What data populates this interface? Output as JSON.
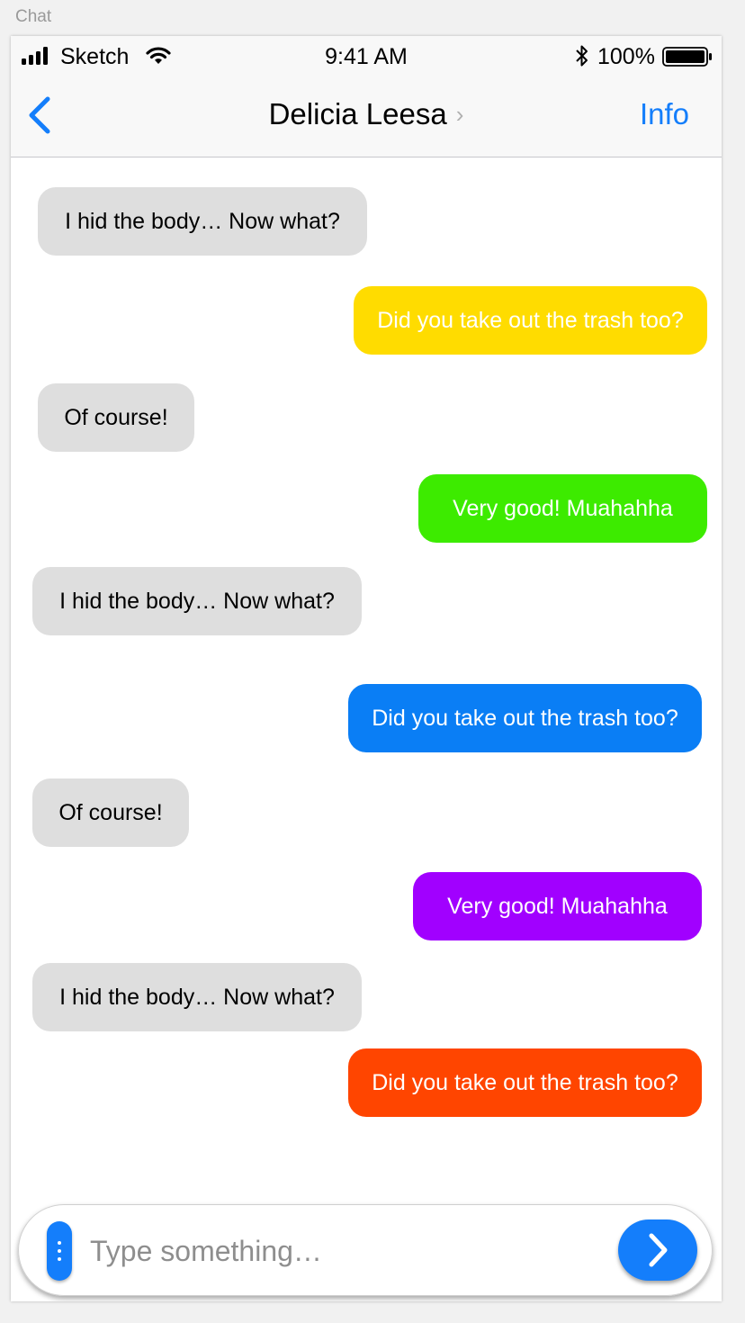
{
  "artboard": {
    "label": "Chat"
  },
  "status_bar": {
    "carrier": "Sketch",
    "time": "9:41 AM",
    "battery": "100%"
  },
  "nav": {
    "title": "Delicia Leesa",
    "title_chevron": "›",
    "info_label": "Info",
    "back_icon": "chevron-left-icon"
  },
  "colors": {
    "accent": "#147EFB",
    "incoming": "#DEDEDE",
    "yellow": "#FFDC00",
    "green": "#3DEB00",
    "blue": "#0A7EF5",
    "purple": "#A100FF",
    "orange": "#FF4500"
  },
  "messages": [
    {
      "direction": "incoming",
      "text": "I hid the body… Now what?",
      "color": "#DEDEDE"
    },
    {
      "direction": "outgoing",
      "text": "Did you take out the trash too?",
      "color": "#FFDC00"
    },
    {
      "direction": "incoming",
      "text": "Of course!",
      "color": "#DEDEDE"
    },
    {
      "direction": "outgoing",
      "text": "Very good! Muahahha",
      "color": "#3DEB00"
    },
    {
      "direction": "incoming",
      "text": "I hid the body… Now what?",
      "color": "#DEDEDE"
    },
    {
      "direction": "outgoing",
      "text": "Did you take out the trash too?",
      "color": "#0A7EF5"
    },
    {
      "direction": "incoming",
      "text": "Of course!",
      "color": "#DEDEDE"
    },
    {
      "direction": "outgoing",
      "text": "Very good! Muahahha",
      "color": "#A100FF"
    },
    {
      "direction": "incoming",
      "text": "I hid the body… Now what?",
      "color": "#DEDEDE"
    },
    {
      "direction": "outgoing",
      "text": "Did you take out the trash too?",
      "color": "#FF4500"
    }
  ],
  "composer": {
    "placeholder": "Type something…",
    "value": "",
    "more_icon": "vertical-dots-icon",
    "send_icon": "chevron-right-icon"
  }
}
